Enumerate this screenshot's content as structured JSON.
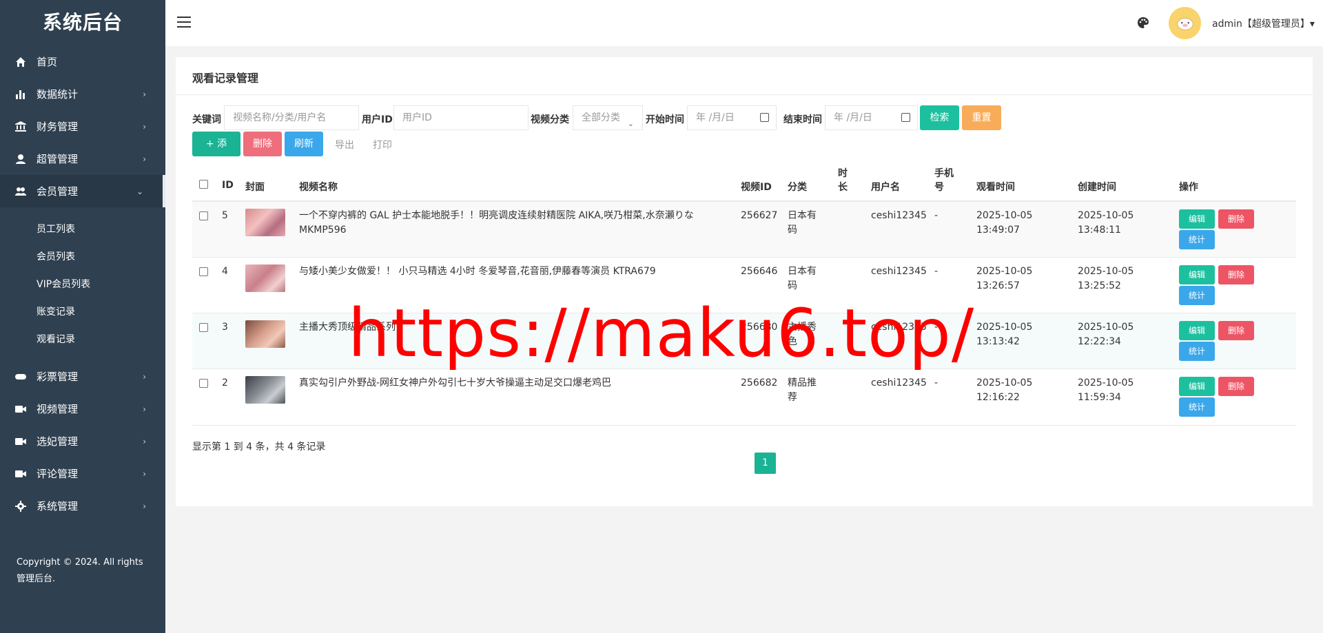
{
  "sidebar": {
    "brand": "系统后台",
    "menu": [
      {
        "label": "首页",
        "icon": "home-icon",
        "arrow": ""
      },
      {
        "label": "数据统计",
        "icon": "bar-chart-icon",
        "arrow": "›"
      },
      {
        "label": "财务管理",
        "icon": "bank-icon",
        "arrow": "›"
      },
      {
        "label": "超管管理",
        "icon": "user-icon",
        "arrow": "›"
      },
      {
        "label": "会员管理",
        "icon": "users-icon",
        "arrow": "⌄"
      }
    ],
    "submenu": [
      "员工列表",
      "会员列表",
      "VIP会员列表",
      "账变记录",
      "观看记录"
    ],
    "menu2": [
      {
        "label": "彩票管理",
        "icon": "gamepad-icon",
        "arrow": "›"
      },
      {
        "label": "视频管理",
        "icon": "video-icon",
        "arrow": "›"
      },
      {
        "label": "选妃管理",
        "icon": "video-icon",
        "arrow": "›"
      },
      {
        "label": "评论管理",
        "icon": "video-icon",
        "arrow": "›"
      },
      {
        "label": "系统管理",
        "icon": "gear-icon",
        "arrow": "›"
      }
    ],
    "copyright": "Copyright © 2024. All rights 管理后台."
  },
  "header": {
    "user": "admin【超级管理员】▾"
  },
  "panel": {
    "title": "观看记录管理",
    "filters": {
      "keyword_label": "关键词",
      "keyword_placeholder": "视频名称/分类/用户名",
      "userid_label": "用户ID",
      "userid_placeholder": "用户ID",
      "category_label": "视频分类",
      "category_value": "全部分类",
      "start_label": "开始时间",
      "end_label": "结束时间",
      "date_placeholder": "年 /月/日",
      "search": "检索",
      "reset": "重置"
    },
    "toolbar": {
      "add": "+ 添加",
      "delete": "删除",
      "refresh": "刷新",
      "export": "导出",
      "print": "打印"
    },
    "columns": {
      "id": "ID",
      "cover": "封面",
      "name": "视频名称",
      "video_id": "视频ID",
      "category": "分类",
      "duration_1": "时",
      "duration_2": "长",
      "username": "用户名",
      "phone_1": "手机",
      "phone_2": "号",
      "watch_time": "观看时间",
      "create_time": "创建时间",
      "actions": "操作"
    },
    "rows": [
      {
        "id": "5",
        "name_1": "一个不穿内裤的 GAL 护士本能地脱手！！明亮调皮连续射精医院 AIKA,咲乃柑菜,水奈瀬りな",
        "name_2": "MKMP596",
        "video_id": "256627",
        "cat_1": "日本有",
        "cat_2": "码",
        "username": "ceshi12345",
        "phone": "-",
        "watch_1": "2025-10-05",
        "watch_2": "13:49:07",
        "create_1": "2025-10-05",
        "create_2": "13:48:11"
      },
      {
        "id": "4",
        "name_1": "与矮小美少女做爱！！ 小只马精选 4小时 冬爱琴音,花音丽,伊藤春等演员 KTRA679",
        "name_2": "",
        "video_id": "256646",
        "cat_1": "日本有",
        "cat_2": "码",
        "username": "ceshi12345",
        "phone": "-",
        "watch_1": "2025-10-05",
        "watch_2": "13:26:57",
        "create_1": "2025-10-05",
        "create_2": "13:25:52"
      },
      {
        "id": "3",
        "name_1": "主播大秀顶级精品系列",
        "name_2": "",
        "video_id": "256680",
        "cat_1": "主播秀",
        "cat_2": "色",
        "username": "ceshi12345",
        "phone": "-",
        "watch_1": "2025-10-05",
        "watch_2": "13:13:42",
        "create_1": "2025-10-05",
        "create_2": "12:22:34"
      },
      {
        "id": "2",
        "name_1": "真实勾引户外野战-网红女神户外勾引七十岁大爷操逼主动足交口爆老鸡巴",
        "name_2": "",
        "video_id": "256682",
        "cat_1": "精品推",
        "cat_2": "荐",
        "username": "ceshi12345",
        "phone": "-",
        "watch_1": "2025-10-05",
        "watch_2": "12:16:22",
        "create_1": "2025-10-05",
        "create_2": "11:59:34"
      }
    ],
    "row_actions": {
      "edit": "编辑",
      "delete": "删除",
      "stats": "统计"
    },
    "pager_info": "显示第 1 到 4 条，共 4 条记录",
    "page": "1"
  },
  "watermark": "https://maku6.top/",
  "colors": {
    "sidebar": "#2f4050",
    "green": "#1ab394",
    "teal": "#1cc09f",
    "red": "#ed5565",
    "blue": "#3aa7ea",
    "orange": "#f8ac59"
  }
}
